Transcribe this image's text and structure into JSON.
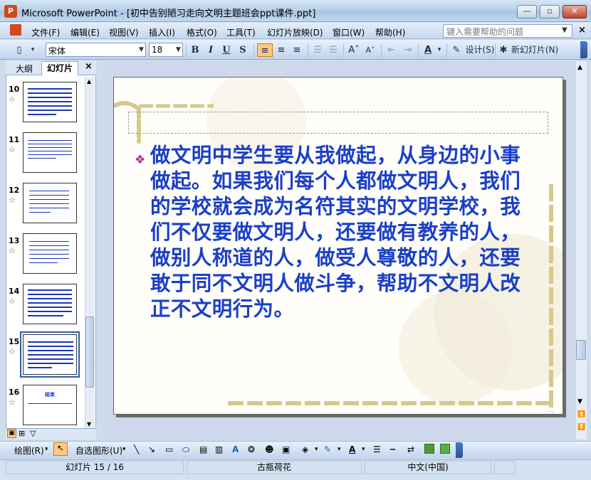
{
  "window": {
    "title": "Microsoft PowerPoint - [初中告别陋习走向文明主题班会ppt课件.ppt]",
    "app_icon": "P"
  },
  "menu": {
    "items": [
      "文件(F)",
      "编辑(E)",
      "视图(V)",
      "插入(I)",
      "格式(O)",
      "工具(T)",
      "幻灯片放映(D)",
      "窗口(W)",
      "帮助(H)"
    ],
    "help_placeholder": "键入需要帮助的问题"
  },
  "toolbar": {
    "font": "宋体",
    "size": "18",
    "bold": "B",
    "italic": "I",
    "underline": "U",
    "shadow": "S",
    "design_label": "设计(S)",
    "new_slide_label": "新幻灯片(N)"
  },
  "panel": {
    "tab_outline": "大纲",
    "tab_slides": "幻灯片",
    "close": "×",
    "slides": [
      {
        "num": "10"
      },
      {
        "num": "11"
      },
      {
        "num": "12"
      },
      {
        "num": "13"
      },
      {
        "num": "14"
      },
      {
        "num": "15"
      },
      {
        "num": "16",
        "title": "结束"
      }
    ]
  },
  "slide": {
    "body": "做文明中学生要从我做起，从身边的小事做起。如果我们每个人都做文明人，我们的学校就会成为名符其实的文明学校，我们不仅要做文明人，还要做有教养的人，做别人称道的人，做受人尊敬的人，还要敢于同不文明人做斗争，帮助不文明人改正不文明行为。"
  },
  "drawbar": {
    "draw_label": "绘图(R)",
    "autoshapes_label": "自选图形(U)"
  },
  "status": {
    "slide_pos": "幻灯片 15 / 16",
    "design": "古瓶荷花",
    "language": "中文(中国)"
  },
  "colors": {
    "text_blue": "#1b3fc8",
    "bullet_magenta": "#b32a80",
    "accent_blue": "#2d5fa2"
  }
}
